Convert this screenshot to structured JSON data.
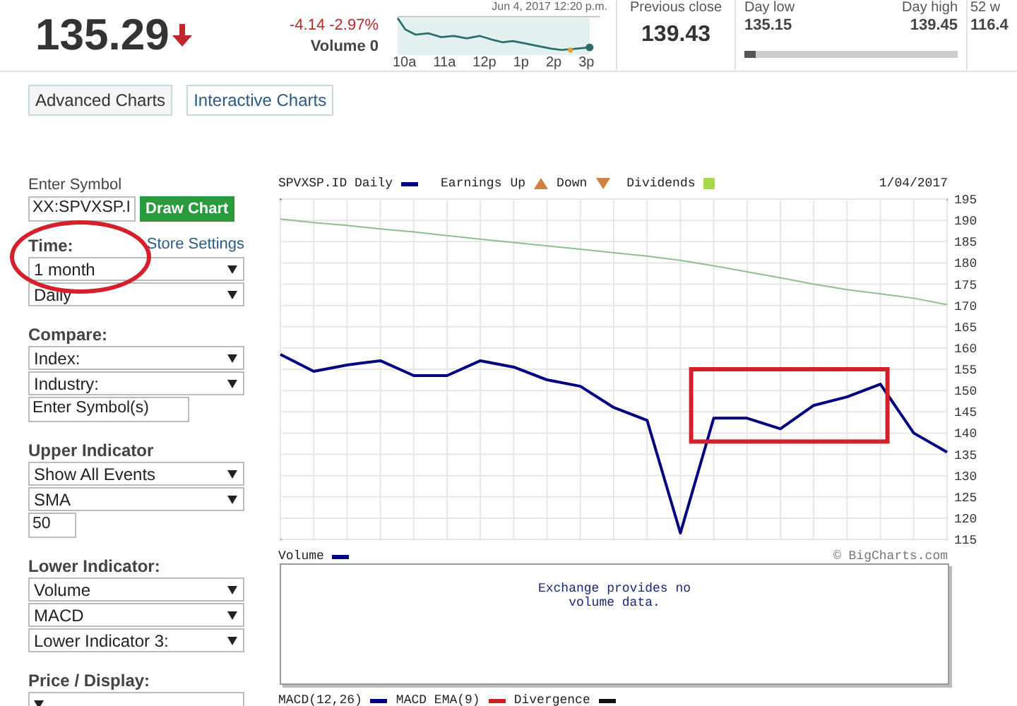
{
  "quote": {
    "price": "135.29",
    "change": "-4.14 -2.97%",
    "volume": "Volume 0",
    "timestamp": "Jun 4, 2017 12:20 p.m.",
    "time_labels": [
      "10a",
      "11a",
      "12p",
      "1p",
      "2p",
      "3p"
    ]
  },
  "previous_close": {
    "label": "Previous close",
    "value": "139.43"
  },
  "day_range": {
    "low_label": "Day low",
    "low": "135.15",
    "high_label": "Day high",
    "high": "139.45",
    "level": 0.05
  },
  "week52": {
    "label": "52 w",
    "value": "116.4"
  },
  "chart_buttons": [
    {
      "label": "Advanced Charts",
      "selected": true
    },
    {
      "label": "Interactive Charts",
      "selected": false
    }
  ],
  "sidebar": {
    "symbol_label": "Enter Symbol",
    "symbol_value": "XX:SPVXSP.I",
    "draw_button": "Draw Chart",
    "store_settings": "Store Settings",
    "sections": [
      {
        "title": "Time:",
        "annotation": {
          "kind": "circle"
        },
        "controls": [
          {
            "kind": "select",
            "value": "1 month"
          },
          {
            "kind": "select",
            "value": "Daily"
          }
        ]
      },
      {
        "title": "Compare:",
        "controls": [
          {
            "kind": "select",
            "value": "Index:"
          },
          {
            "kind": "select",
            "value": "Industry:"
          },
          {
            "kind": "input",
            "value": "Enter Symbol(s)"
          }
        ]
      },
      {
        "title": "Upper Indicator",
        "controls": [
          {
            "kind": "select",
            "value": "Show All Events"
          },
          {
            "kind": "select",
            "value": "SMA"
          },
          {
            "kind": "input",
            "value": "50"
          }
        ]
      },
      {
        "title": "Lower Indicator:",
        "controls": [
          {
            "kind": "select",
            "value": "Volume"
          },
          {
            "kind": "select",
            "value": "MACD"
          },
          {
            "kind": "select",
            "value": "Lower Indicator 3:"
          }
        ]
      },
      {
        "title": "Price / Display:",
        "controls": [
          {
            "kind": "select"
          }
        ]
      }
    ]
  },
  "price_chart": {
    "annotation": {
      "kind": "rectangle"
    },
    "legend": {
      "earnings": "Earnings",
      "up": "Up",
      "down": "Down",
      "dividends": "Dividends"
    },
    "date": "1/04/2017",
    "chart_data": {
      "type": "line",
      "grid": true,
      "ylim": [
        115,
        195
      ],
      "yticks": [
        115,
        120,
        125,
        130,
        135,
        140,
        145,
        150,
        155,
        160,
        165,
        170,
        175,
        180,
        185,
        190,
        195
      ],
      "series": [
        {
          "name": "SPVXSP.ID Daily",
          "color": "#000080",
          "values": [
            158.5,
            154.5,
            156,
            157,
            153.5,
            153.5,
            157,
            155.5,
            152.5,
            151,
            146,
            143,
            116.5,
            143.5,
            143.5,
            141,
            146.5,
            148.5,
            151.5,
            140,
            135.5
          ]
        },
        {
          "color": "#8fbf8f",
          "values": [
            190.3,
            189.5,
            188.8,
            188,
            187.3,
            186.4,
            185.6,
            184.8,
            184,
            183.2,
            182.4,
            181.6,
            180.6,
            179.3,
            177.9,
            176.5,
            175,
            173.7,
            172.7,
            171.7,
            170.2
          ]
        }
      ]
    }
  },
  "volume_panel": {
    "label": "Volume",
    "message": "Exchange provides no volume data.",
    "copyright": "© BigCharts.com"
  },
  "macd_legend": [
    {
      "label": "MACD(12,26)",
      "color": "#000080"
    },
    {
      "label": "MACD EMA(9)",
      "color": "#cc2222"
    },
    {
      "label": "Divergence",
      "color": "#111111"
    }
  ]
}
